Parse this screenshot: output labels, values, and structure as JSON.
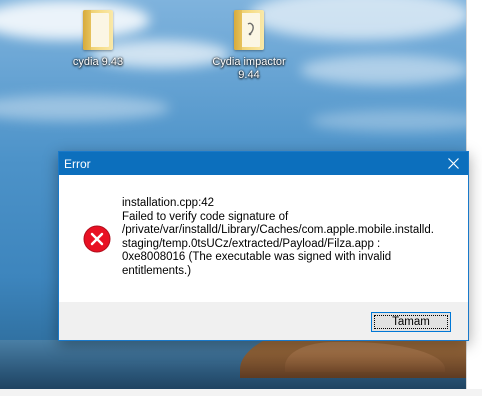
{
  "desktop": {
    "icons": [
      {
        "label": "cydia 9.43"
      },
      {
        "label": "Cydia impactor 9.44"
      }
    ]
  },
  "dialog": {
    "title": "Error",
    "message_lines": [
      "installation.cpp:42",
      "Failed to verify code signature of",
      "/private/var/installd/Library/Caches/com.apple.mobile.installd.",
      "staging/temp.0tsUCz/extracted/Payload/Filza.app :",
      "0xe8008016 (The executable was signed with invalid",
      "entitlements.)"
    ],
    "ok_label": "Tamam",
    "icons": {
      "status": "error-icon",
      "close": "close-icon"
    }
  },
  "colors": {
    "titlebar": "#0c6fbd",
    "error_red": "#e81123",
    "button_focus": "#0078d7"
  }
}
